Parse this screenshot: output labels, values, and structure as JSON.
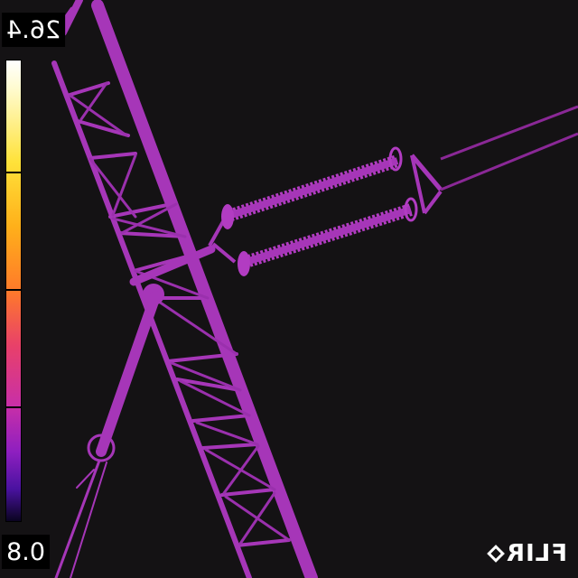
{
  "readout": {
    "max_temp": "26.4",
    "min_temp": "0.8"
  },
  "brand": {
    "name": "FLIR",
    "icon": "flir-diamond-icon"
  },
  "palette": {
    "background": "#141214",
    "structure": "#b23cc2",
    "structure_edge": "#8a2896",
    "highlight": "#d050d8"
  }
}
